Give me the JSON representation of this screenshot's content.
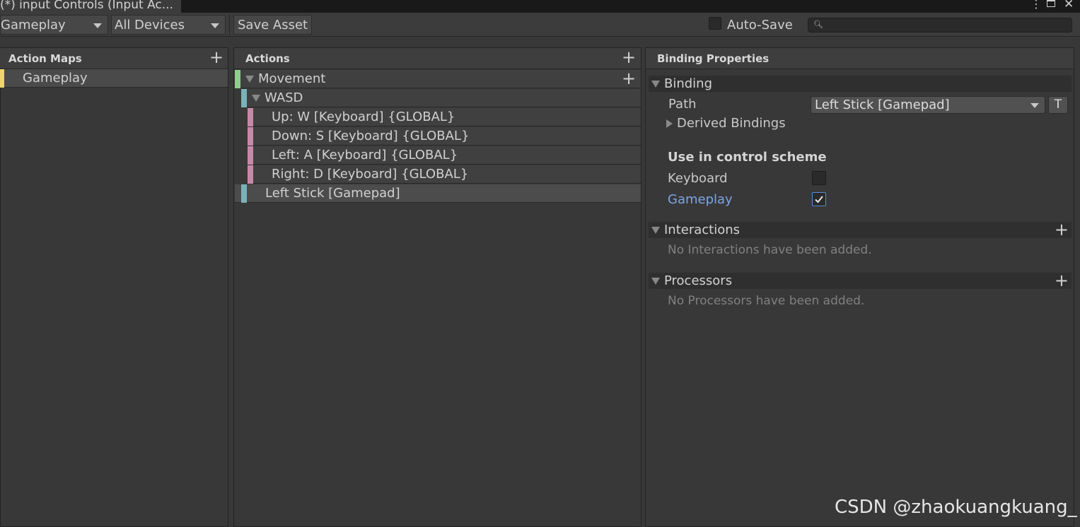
{
  "window": {
    "tab_title": "(*) input Controls (Input Ac..."
  },
  "toolbar": {
    "action_map_select": "Gameplay",
    "device_select": "All Devices",
    "save_label": "Save Asset",
    "autosave_label": "Auto-Save",
    "autosave_checked": false,
    "search_placeholder": ""
  },
  "action_maps": {
    "title": "Action Maps",
    "items": [
      {
        "label": "Gameplay",
        "color": "#f0d46a",
        "selected": true
      }
    ]
  },
  "actions": {
    "title": "Actions",
    "rows": [
      {
        "label": "Movement",
        "type": "action",
        "color": "#8dcf8a"
      },
      {
        "label": "WASD",
        "type": "composite",
        "color": "#7ab2b8"
      },
      {
        "label": "Up: W [Keyboard] {GLOBAL}",
        "type": "part",
        "color": "#c68aa6"
      },
      {
        "label": "Down: S [Keyboard] {GLOBAL}",
        "type": "part",
        "color": "#c68aa6"
      },
      {
        "label": "Left: A [Keyboard] {GLOBAL}",
        "type": "part",
        "color": "#c68aa6"
      },
      {
        "label": "Right: D [Keyboard] {GLOBAL}",
        "type": "part",
        "color": "#c68aa6"
      },
      {
        "label": "Left Stick [Gamepad]",
        "type": "binding",
        "color": "#7ab2b8",
        "selected": true
      }
    ]
  },
  "properties": {
    "title": "Binding Properties",
    "binding_section": "Binding",
    "path_label": "Path",
    "path_value": "Left Stick [Gamepad]",
    "t_button": "T",
    "derived_label": "Derived Bindings",
    "control_scheme_title": "Use in control scheme",
    "schemes": [
      {
        "label": "Keyboard",
        "checked": false
      },
      {
        "label": "Gameplay",
        "checked": true
      }
    ],
    "interactions_section": "Interactions",
    "interactions_empty": "No Interactions have been added.",
    "processors_section": "Processors",
    "processors_empty": "No Processors have been added."
  },
  "watermark": "CSDN @zhaokuangkuang_",
  "colors": {
    "accent_link": "#7ba5e6",
    "checkmark": "#e8e8e8"
  }
}
